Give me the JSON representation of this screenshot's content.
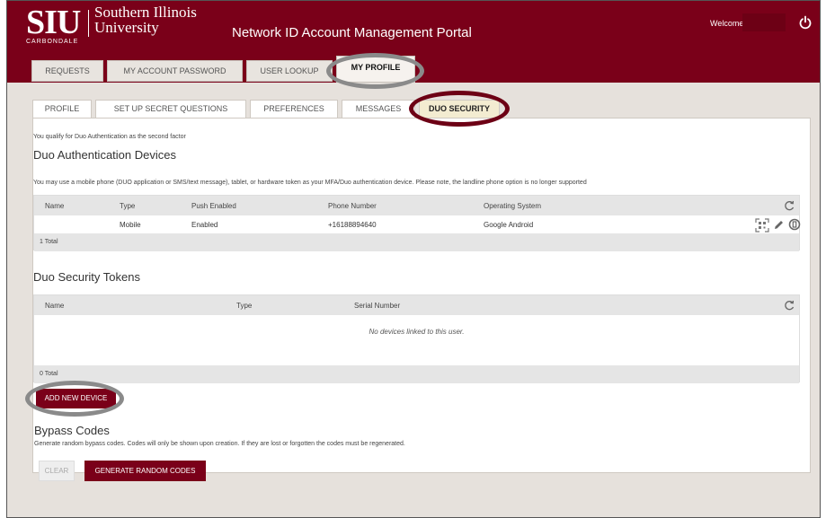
{
  "header": {
    "logo_abbr": "SIU",
    "logo_name_line1": "Southern Illinois",
    "logo_name_line2": "University",
    "logo_sub": "CARBONDALE",
    "portal_title": "Network ID Account Management Portal",
    "welcome": "Welcome,",
    "power_icon": "power-icon"
  },
  "main_nav": {
    "tabs": [
      {
        "label": "REQUESTS",
        "active": false
      },
      {
        "label": "MY ACCOUNT PASSWORD",
        "active": false
      },
      {
        "label": "USER LOOKUP",
        "active": false
      },
      {
        "label": "MY PROFILE",
        "active": true
      }
    ]
  },
  "sub_nav": {
    "tabs": [
      {
        "label": "PROFILE",
        "active": false
      },
      {
        "label": "SET UP SECRET QUESTIONS",
        "active": false
      },
      {
        "label": "PREFERENCES",
        "active": false
      },
      {
        "label": "MESSAGES",
        "active": false
      },
      {
        "label": "DUO SECURITY",
        "active": true
      }
    ]
  },
  "duo": {
    "qualify_text": "You qualify for Duo Authentication as the second factor",
    "devices_title": "Duo Authentication Devices",
    "devices_note": "You may use a mobile phone (DUO application or SMS/text message), tablet, or hardware token as your MFA/Duo authentication device. Please note, the landline phone option is no longer supported",
    "devices_table": {
      "columns": [
        "Name",
        "Type",
        "Push Enabled",
        "Phone Number",
        "Operating System"
      ],
      "rows": [
        {
          "name": "",
          "type": "Mobile",
          "push": "Enabled",
          "phone": "+16188894640",
          "os": "Google Android"
        }
      ],
      "total": "1 Total",
      "row_icons": [
        "qr-code-icon",
        "pencil-icon",
        "trash-icon"
      ]
    },
    "tokens_title": "Duo Security Tokens",
    "tokens_table": {
      "columns": [
        "Name",
        "Type",
        "Serial Number"
      ],
      "empty_text": "No devices linked to this user.",
      "total": "0 Total"
    },
    "add_button": "ADD NEW DEVICE",
    "bypass_title": "Bypass Codes",
    "bypass_text": "Generate random bypass codes. Codes will only be shown upon creation. If they are lost or forgotten the codes must be regenerated.",
    "clear_button": "CLEAR",
    "generate_button": "GENERATE RANDOM CODES"
  },
  "colors": {
    "brand_maroon": "#7a0019",
    "highlight_gray": "#8a8a8a",
    "highlight_maroon": "#6d0015"
  }
}
